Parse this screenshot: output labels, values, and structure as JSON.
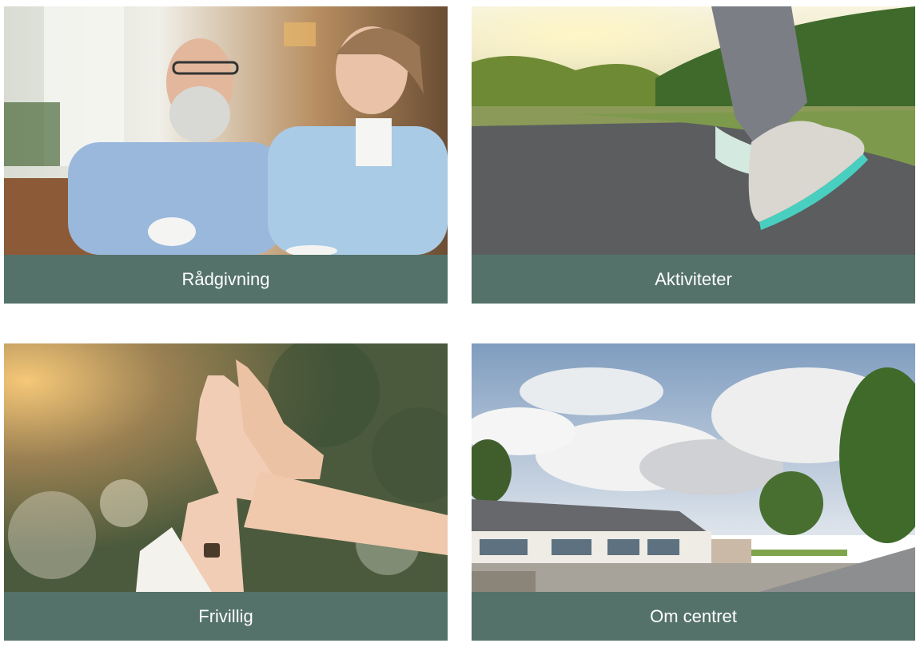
{
  "cards": [
    {
      "label": "Rådgivning",
      "photo": "elderly-couple-coffee-photo"
    },
    {
      "label": "Aktiviteter",
      "photo": "walking-feet-path-photo"
    },
    {
      "label": "Frivillig",
      "photo": "high-five-hands-photo"
    },
    {
      "label": "Om centret",
      "photo": "centre-building-street-photo"
    }
  ],
  "colors": {
    "caption_bg": "#547269",
    "caption_text": "#ffffff"
  }
}
